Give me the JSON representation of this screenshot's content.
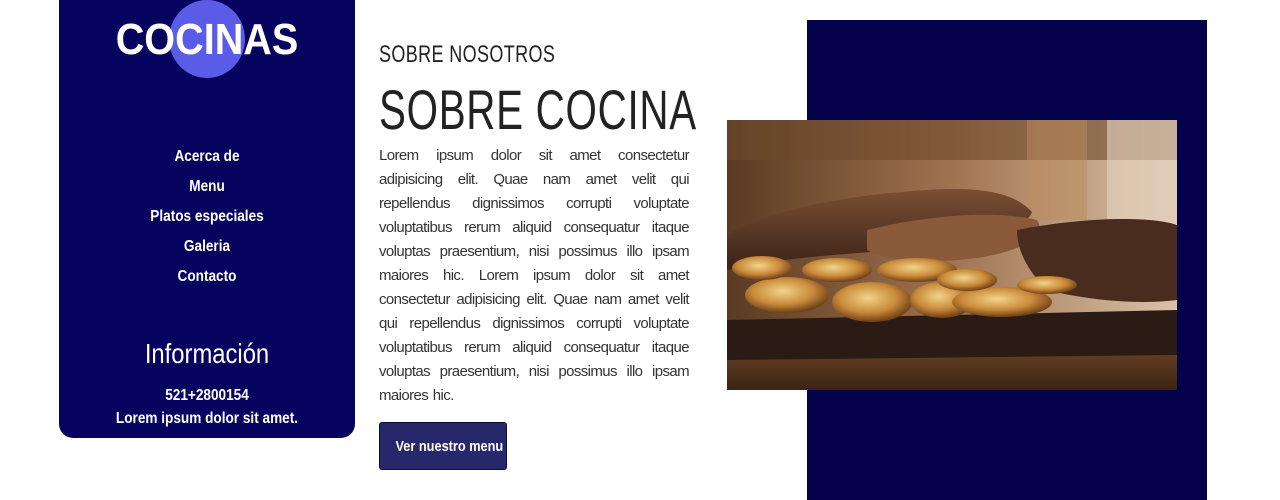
{
  "brand": {
    "logo_text": "COCINAS",
    "colors": {
      "sidebar": "#06045e",
      "logo_circle": "#5a5be6",
      "image_block": "#03024a",
      "button": "#27276b"
    }
  },
  "sidebar": {
    "nav": [
      {
        "label": "Acerca de"
      },
      {
        "label": "Menu"
      },
      {
        "label": "Platos especiales"
      },
      {
        "label": "Galeria"
      },
      {
        "label": "Contacto"
      }
    ],
    "info": {
      "title": "Información",
      "phone": "521+2800154",
      "text": "Lorem ipsum dolor sit amet."
    }
  },
  "about": {
    "eyebrow": "SOBRE NOSOTROS",
    "heading": "SOBRE COCINA",
    "body": "Lorem ipsum dolor sit amet consectetur adipisicing elit. Quae nam amet velit qui repellendus dignissimos corrupti voluptate voluptatibus rerum aliquid consequatur itaque voluptas praesentium, nisi possimus illo ipsam maiores hic. Lorem ipsum dolor sit amet consectetur adipisicing elit. Quae nam amet velit qui repellendus dignissimos corrupti voluptate voluptatibus rerum aliquid consequatur itaque voluptas praesentium, nisi possimus illo ipsam maiores hic.",
    "button_label": "Ver nuestro menu"
  },
  "image": {
    "subject": "steak-with-grilled-onions-photo"
  }
}
